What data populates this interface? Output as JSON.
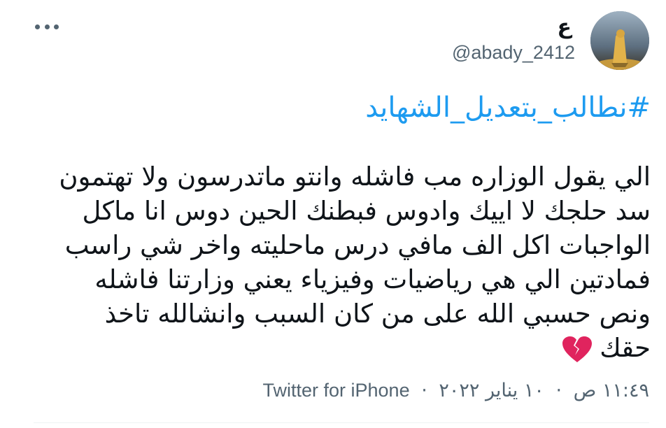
{
  "user": {
    "display_name": "ع",
    "handle": "@abady_2412"
  },
  "tweet": {
    "hashtag": "#نطالب_بتعديل_الشهايد",
    "lines": [
      "الي يقول الوزاره مب فاشله وانتو ماتدرسون ولا تهتمون",
      "سد حلجك لا اييك وادوس فبطنك الحين دوس انا ماكل",
      "الواجبات اكل الف مافي درس ماحليته واخر شي راسب",
      "فمادتين الي هي رياضيات وفيزياء يعني وزارتنا فاشله",
      "ونص حسبي الله على من كان السبب وانشالله تاخذ",
      "حقك"
    ],
    "emoji": "broken-heart-icon"
  },
  "meta": {
    "time": "١١:٤٩ ص",
    "date": "١٠ يناير ٢٠٢٢",
    "separator": "·",
    "source": "Twitter for iPhone"
  },
  "colors": {
    "link": "#1d9bf0",
    "secondary": "#536471",
    "text": "#0f1419",
    "heart": "#e0245e"
  }
}
